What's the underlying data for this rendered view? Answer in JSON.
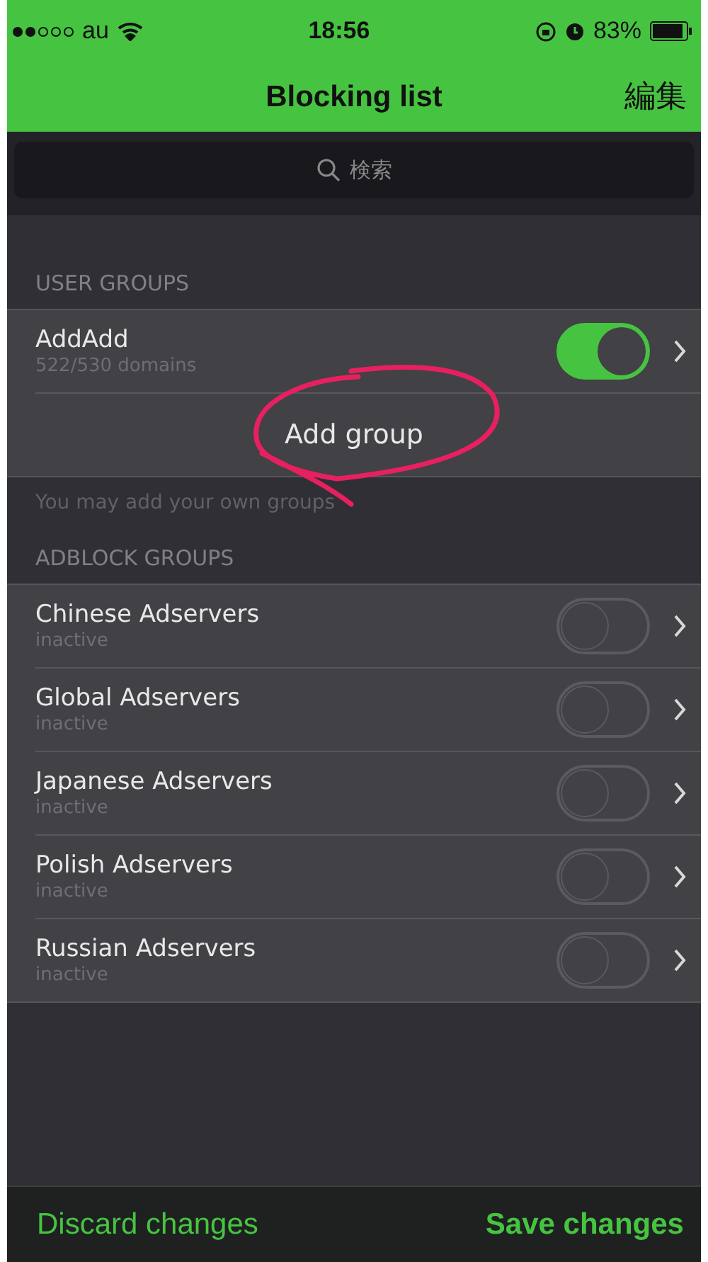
{
  "status_bar": {
    "carrier": "au",
    "time": "18:56",
    "battery": "83%"
  },
  "nav": {
    "title": "Blocking list",
    "action": "編集"
  },
  "search": {
    "placeholder": "検索"
  },
  "user_groups": {
    "header": "USER GROUPS",
    "groups": [
      {
        "name": "AddAdd",
        "detail": "522/530 domains",
        "on": true
      }
    ],
    "add_button": "Add group",
    "footer": "You may add your own groups"
  },
  "adblock_groups": {
    "header": "ADBLOCK GROUPS",
    "groups": [
      {
        "name": "Chinese Adservers",
        "detail": "inactive",
        "on": false
      },
      {
        "name": "Global Adservers",
        "detail": "inactive",
        "on": false
      },
      {
        "name": "Japanese Adservers",
        "detail": "inactive",
        "on": false
      },
      {
        "name": "Polish Adservers",
        "detail": "inactive",
        "on": false
      },
      {
        "name": "Russian Adservers",
        "detail": "inactive",
        "on": false
      }
    ]
  },
  "toolbar": {
    "discard": "Discard changes",
    "save": "Save changes"
  }
}
